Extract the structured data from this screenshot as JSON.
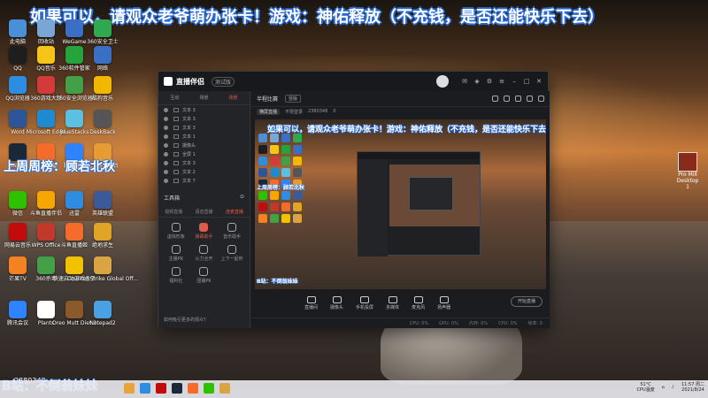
{
  "overlay": {
    "top_banner": "如果可以，请观众老爷萌办张卡！游戏：神佑释放（不充钱，是否还能快乐下去）",
    "side_banner": "上周周榜：顾若北秋",
    "bottom_banner": "B站：不倒翁妹妹",
    "bottom_number": "2380348"
  },
  "desktop_icons": [
    {
      "label": "此电脑",
      "color": "#4a90d9"
    },
    {
      "label": "回收站",
      "color": "#7aa6d6"
    },
    {
      "label": "WeGame",
      "color": "#3a6fc5"
    },
    {
      "label": "360安全卫士",
      "color": "#2fa84f"
    },
    {
      "label": "QQ",
      "color": "#1e1e1e"
    },
    {
      "label": "QQ音乐",
      "color": "#f5c518"
    },
    {
      "label": "360软件管家",
      "color": "#27a33e"
    },
    {
      "label": "网络",
      "color": "#3a6fc5"
    },
    {
      "label": "QQ浏览器",
      "color": "#2e8de0"
    },
    {
      "label": "360游戏大厅",
      "color": "#d33b3b"
    },
    {
      "label": "360安全浏览器",
      "color": "#43a047"
    },
    {
      "label": "酷狗音乐",
      "color": "#f2b800"
    },
    {
      "label": "Word",
      "color": "#2b579a"
    },
    {
      "label": "Microsoft Edge",
      "color": "#1f8ad2"
    },
    {
      "label": "BlueStacks",
      "color": "#5cc0e0"
    },
    {
      "label": "DeskBack",
      "color": "#555"
    },
    {
      "label": "Steam",
      "color": "#1b2838"
    },
    {
      "label": "斗鱼直播",
      "color": "#f46b2a"
    },
    {
      "label": "腾讯视频",
      "color": "#2f83ff"
    },
    {
      "label": "光荣游戏平台",
      "color": "#e79b33"
    },
    {
      "label": "微信",
      "color": "#2dc100"
    },
    {
      "label": "斗鱼直播伴侣",
      "color": "#f7a600"
    },
    {
      "label": "迅雷",
      "color": "#2e8de0"
    },
    {
      "label": "英雄联盟",
      "color": "#3b5a9a"
    },
    {
      "label": "网易云音乐",
      "color": "#c20c0c"
    },
    {
      "label": "WPS Office",
      "color": "#c0392b"
    },
    {
      "label": "斗鱼直播姬",
      "color": "#f46b2a"
    },
    {
      "label": "绝地求生",
      "color": "#e0a526"
    },
    {
      "label": "芒果TV",
      "color": "#f58220"
    },
    {
      "label": "360杀毒",
      "color": "#43a047"
    },
    {
      "label": "快速启动游戏盒子",
      "color": "#f2c200"
    },
    {
      "label": "Counter-Strike Global Off...",
      "color": "#d9a441"
    },
    {
      "label": "腾讯会议",
      "color": "#2f83ff"
    },
    {
      "label": "Plants",
      "color": "#ffffff"
    },
    {
      "label": "Oreo Mutt Diet 3",
      "color": "#8b5a2b"
    },
    {
      "label": "Notepad2",
      "color": "#4aa0e0"
    }
  ],
  "right_icon": {
    "label": "Pro Mill Desktop 1"
  },
  "app": {
    "name": "直播伴侣",
    "version": "测试版",
    "left_tabs": [
      "互动",
      "场景",
      "场景"
    ],
    "left_active": 2,
    "scenes": [
      "文本 3",
      "文本 3",
      "文本 3",
      "文本 1",
      "摄像头",
      "全屏 1",
      "文本 3",
      "文本 2",
      "文本 7"
    ],
    "tool_header": "工具箱",
    "tool_tabs": [
      "视频直播",
      "语音直播",
      "连麦直播"
    ],
    "tool_active": 2,
    "tools": [
      {
        "label": "虚拟形象",
        "hot": false
      },
      {
        "label": "弹幕助手",
        "hot": true
      },
      {
        "label": "音乐助手",
        "hot": false
      },
      {
        "label": "主播PK",
        "hot": false
      },
      {
        "label": "火力全开",
        "hot": false
      },
      {
        "label": "上下一起听",
        "hot": false
      },
      {
        "label": "福利社",
        "hot": false
      },
      {
        "label": "团播PK",
        "hot": false
      }
    ],
    "left_footer": "如何吸引更多的观众？",
    "main_title": "半程比赛",
    "main_tag": "竖版",
    "sub_pills": [
      "横屏直播"
    ],
    "sub_text": [
      "不限登录",
      "2380348",
      "0"
    ],
    "preview": {
      "banner": "如果可以，请观众老爷萌办张卡！游戏：神佑释放（不充钱，是否还能快乐下去）",
      "side": "上周周榜：顾若北秋",
      "bottom": "B站：不倒翁妹妹"
    },
    "toolbar": [
      {
        "label": "直播间"
      },
      {
        "label": "摄像头"
      },
      {
        "label": "手机投屏"
      },
      {
        "label": "多媒体"
      },
      {
        "label": "麦克风"
      },
      {
        "label": "扬声器"
      }
    ],
    "start_label": "开始直播",
    "status": [
      "CPU: 0%",
      "GPU: 0%",
      "内存: 0%",
      "CPU: 0%",
      "帧率: 0"
    ]
  },
  "taskbar": {
    "icon_colors": [
      "#e9a33a",
      "#2e8de0",
      "#c20c0c",
      "#1b2838",
      "#f46b2a",
      "#2dc100",
      "#d9a441"
    ],
    "temp": "51°C",
    "cpu": "CPU温度",
    "time": "11:57 周二",
    "date": "2021/8/24"
  }
}
